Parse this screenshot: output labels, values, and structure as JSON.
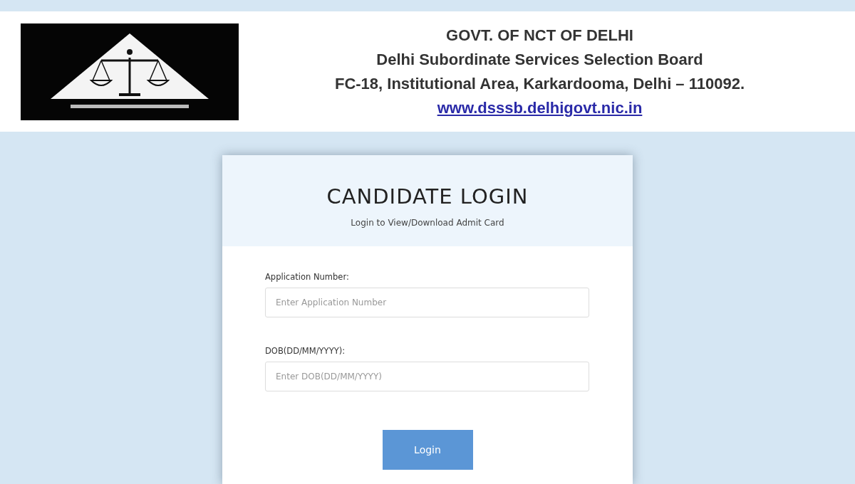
{
  "header": {
    "lines": [
      "GOVT. OF NCT OF DELHI",
      "Delhi Subordinate Services Selection Board",
      "FC-18, Institutional Area, Karkardooma, Delhi – 110092."
    ],
    "link": "www.dsssb.delhigovt.nic.in"
  },
  "login": {
    "title": "CANDIDATE LOGIN",
    "subtitle": "Login to View/Download Admit Card",
    "fields": [
      {
        "label": "Application Number:",
        "placeholder": "Enter Application Number"
      },
      {
        "label": "DOB(DD/MM/YYYY):",
        "placeholder": "Enter DOB(DD/MM/YYYY)"
      }
    ],
    "button": "Login"
  }
}
